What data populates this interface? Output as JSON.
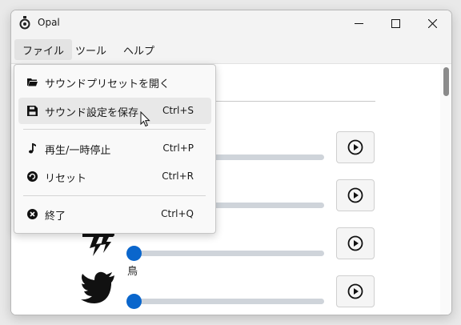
{
  "window": {
    "title": "Opal"
  },
  "menubar": {
    "items": [
      {
        "label": "ファイル"
      },
      {
        "label": "ツール"
      },
      {
        "label": "ヘルプ"
      }
    ]
  },
  "file_menu": {
    "items": [
      {
        "label": "サウンドプリセットを開く",
        "shortcut": "",
        "icon": "folder-open-icon"
      },
      {
        "label": "サウンド設定を保存",
        "shortcut": "Ctrl+S",
        "icon": "save-icon"
      },
      {
        "label": "再生/一時停止",
        "shortcut": "Ctrl+P",
        "icon": "music-note-icon"
      },
      {
        "label": "リセット",
        "shortcut": "Ctrl+R",
        "icon": "reset-icon"
      },
      {
        "label": "終了",
        "shortcut": "Ctrl+Q",
        "icon": "close-circle-icon"
      }
    ]
  },
  "sounds": [
    {
      "label": "",
      "icon": "",
      "volume": 0
    },
    {
      "label": "",
      "icon": "",
      "volume": 0
    },
    {
      "label": "",
      "icon": "thunder-icon",
      "volume": 0
    },
    {
      "label": "鳥",
      "icon": "bird-icon",
      "volume": 0
    }
  ],
  "colors": {
    "accent": "#0a66cc",
    "track": "#cfd4da"
  }
}
